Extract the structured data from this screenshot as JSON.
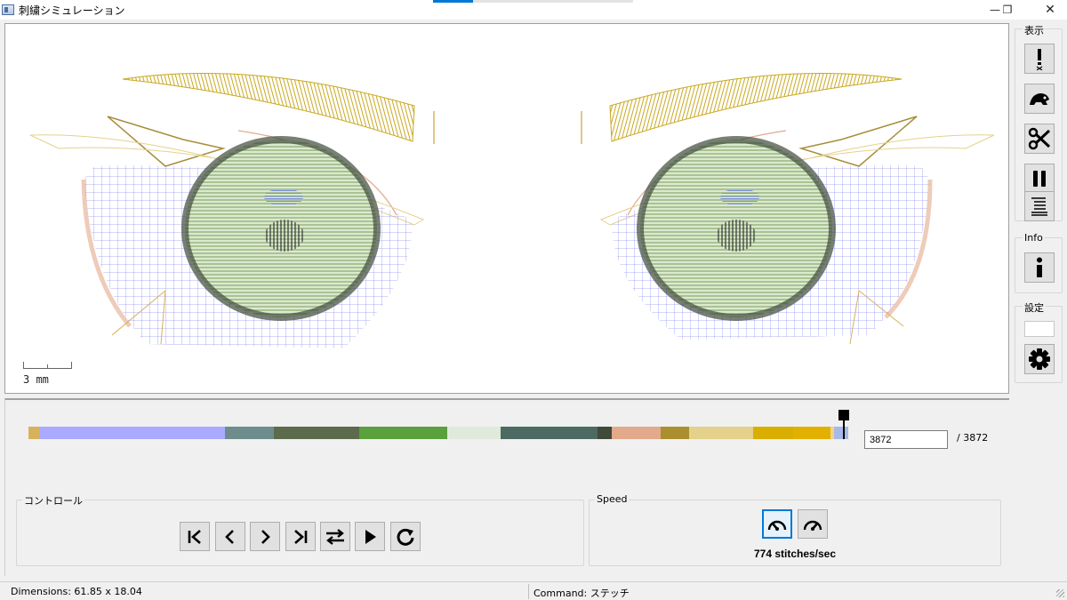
{
  "window": {
    "title": "刺繍シミュレーション",
    "minimize": "—",
    "restore": "❐",
    "close": "✕"
  },
  "canvas": {
    "scale_label": "3 mm"
  },
  "side": {
    "display_group": "表示",
    "info_group": "Info",
    "settings_group": "設定",
    "tools": [
      "jump-icon",
      "tortoise-icon",
      "scissors-icon",
      "pause-icon",
      "list-icon"
    ]
  },
  "colorbar": {
    "segments": [
      {
        "color": "#d6b25c",
        "weight": 12
      },
      {
        "color": "#aaaaff",
        "weight": 208
      },
      {
        "color": "#6f8c8c",
        "weight": 54
      },
      {
        "color": "#5c6b4c",
        "weight": 96
      },
      {
        "color": "#5aa03c",
        "weight": 98
      },
      {
        "color": "#dfeadb",
        "weight": 60
      },
      {
        "color": "#4d6a62",
        "weight": 108
      },
      {
        "color": "#3f4a3a",
        "weight": 16
      },
      {
        "color": "#e2aa8a",
        "weight": 54
      },
      {
        "color": "#ab8e2e",
        "weight": 32
      },
      {
        "color": "#e4d18c",
        "weight": 72
      },
      {
        "color": "#d9ae00",
        "weight": 44
      },
      {
        "color": "#e2b100",
        "weight": 42
      },
      {
        "color": "#f2d38a",
        "weight": 4
      },
      {
        "color": "#a7b9e6",
        "weight": 16
      }
    ],
    "current": "3872",
    "total": "/ 3872"
  },
  "control": {
    "label": "コントロール",
    "buttons": [
      "first-icon",
      "prev-icon",
      "next-icon",
      "last-icon",
      "swap-icon",
      "play-icon",
      "refresh-icon"
    ]
  },
  "speed": {
    "label": "Speed",
    "rate": "774 stitches/sec"
  },
  "status": {
    "dimensions": "Dimensions: 61.85 x 18.04",
    "command": "Command: ステッチ"
  }
}
